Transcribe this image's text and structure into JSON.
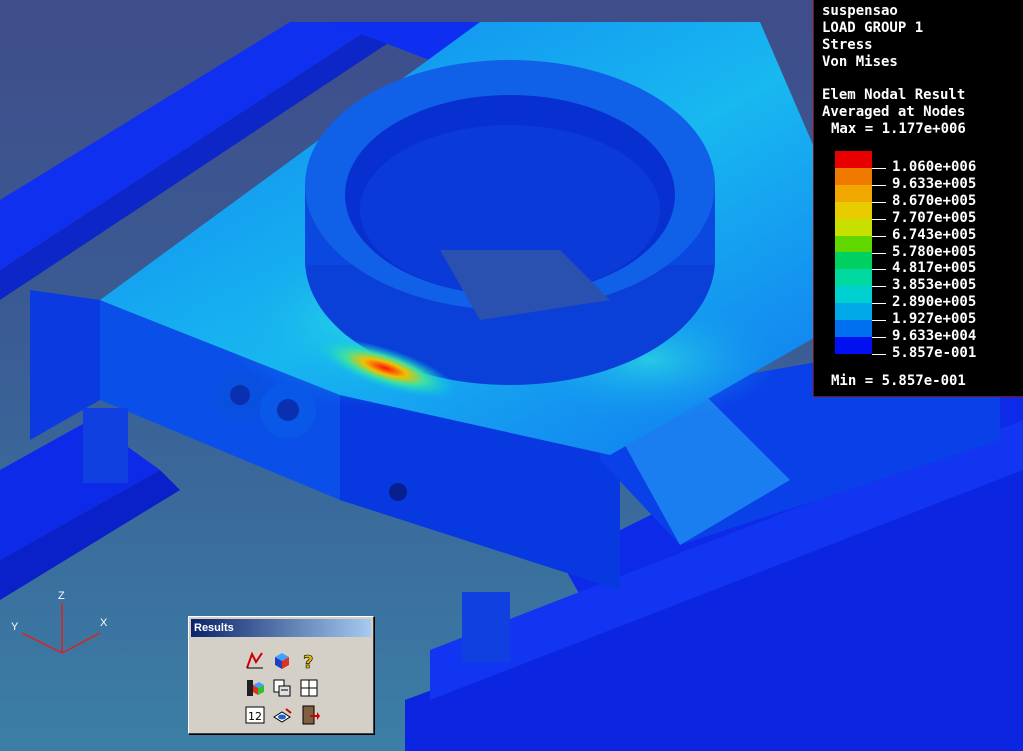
{
  "legend": {
    "model": "suspensao",
    "load_group": "LOAD GROUP 1",
    "quantity": "Stress",
    "component": "Von Mises",
    "result_type": "Elem Nodal Result",
    "averaging": "Averaged at Nodes",
    "max_label": "Max = 1.177e+006",
    "min_label": "Min = 5.857e-001",
    "levels": [
      {
        "value": "1.060e+006",
        "color": "#e80000"
      },
      {
        "value": "9.633e+005",
        "color": "#f07a00"
      },
      {
        "value": "8.670e+005",
        "color": "#f0a800"
      },
      {
        "value": "7.707e+005",
        "color": "#e8cc00"
      },
      {
        "value": "6.743e+005",
        "color": "#c8e000"
      },
      {
        "value": "5.780e+005",
        "color": "#60d800"
      },
      {
        "value": "4.817e+005",
        "color": "#00d060"
      },
      {
        "value": "3.853e+005",
        "color": "#00d8a0"
      },
      {
        "value": "2.890e+005",
        "color": "#00d0d0"
      },
      {
        "value": "1.927e+005",
        "color": "#00a8e8"
      },
      {
        "value": "9.633e+004",
        "color": "#0070f0"
      },
      {
        "value": "5.857e-001",
        "color": "#0010f0"
      }
    ]
  },
  "axis": {
    "z": "Z",
    "y": "Y",
    "x": "X"
  },
  "results_toolbar": {
    "title": "Results",
    "buttons": [
      {
        "icon": "deformed-shape-icon"
      },
      {
        "icon": "fringe-cube-icon"
      },
      {
        "icon": "help-question-icon"
      },
      {
        "icon": "animation-icon"
      },
      {
        "icon": "report-icon"
      },
      {
        "icon": "grid-table-icon"
      },
      {
        "icon": "numeric-values-icon",
        "text": "12"
      },
      {
        "icon": "cutting-plane-icon"
      },
      {
        "icon": "exit-door-icon"
      }
    ]
  }
}
